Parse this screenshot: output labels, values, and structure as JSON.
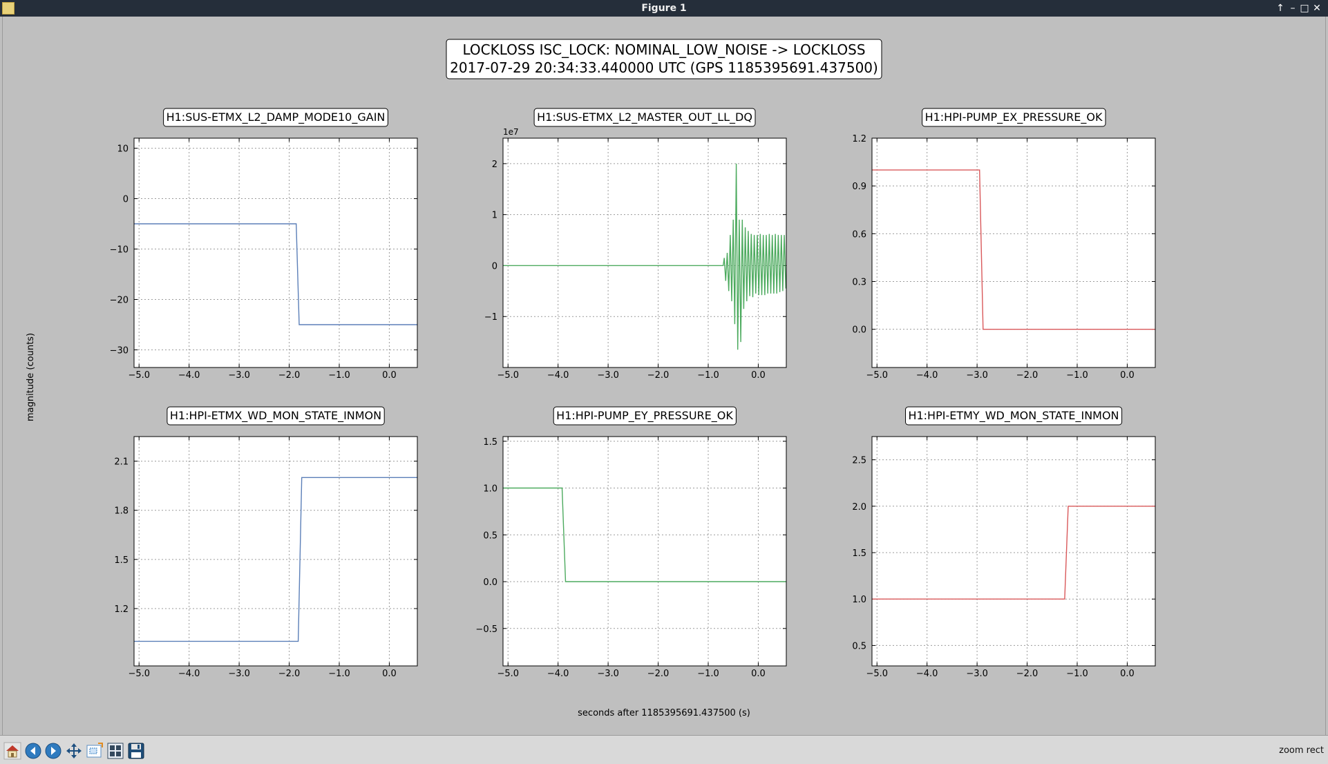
{
  "window": {
    "title": "Figure 1",
    "buttons": {
      "up": "↑",
      "minimize": "–",
      "maximize": "□",
      "close": "✕"
    }
  },
  "figure": {
    "suptitle_line1": "LOCKLOSS ISC_LOCK: NOMINAL_LOW_NOISE -> LOCKLOSS",
    "suptitle_line2": "2017-07-29 20:34:33.440000 UTC (GPS 1185395691.437500)",
    "ylabel": "magnitude (counts)",
    "xlabel": "seconds after 1185395691.437500 (s)"
  },
  "toolbar": {
    "icons": [
      "home-icon",
      "back-arrow-icon",
      "forward-arrow-icon",
      "pan-move-icon",
      "zoom-rect-icon",
      "configure-subplots-icon",
      "save-figure-icon"
    ],
    "status": "zoom rect"
  },
  "chart_data": [
    {
      "type": "line",
      "title": "H1:SUS-ETMX_L2_DAMP_MODE10_GAIN",
      "color": "#5b7fb8",
      "xlim": [
        -5.1,
        0.56
      ],
      "ylim": [
        -33.5,
        12.0
      ],
      "xticks": [
        -5.0,
        -4.0,
        -3.0,
        -2.0,
        -1.0,
        0.0
      ],
      "xtick_labels": [
        "−5.0",
        "−4.0",
        "−3.0",
        "−2.0",
        "−1.0",
        "0.0"
      ],
      "yticks": [
        10,
        0,
        -10,
        -20,
        -30
      ],
      "ytick_labels": [
        "10",
        "0",
        "−10",
        "−20",
        "−30"
      ],
      "grid": true,
      "x": [
        -5.1,
        -1.86,
        -1.8,
        0.56
      ],
      "y": [
        -5,
        -5,
        -25,
        -25
      ]
    },
    {
      "type": "line",
      "title": "H1:SUS-ETMX_L2_MASTER_OUT_LL_DQ",
      "color": "#4caa5e",
      "xlim": [
        -5.1,
        0.56
      ],
      "ylim": [
        -2.0,
        2.5
      ],
      "offset_text": "1e7",
      "xticks": [
        -5.0,
        -4.0,
        -3.0,
        -2.0,
        -1.0,
        0.0
      ],
      "xtick_labels": [
        "−5.0",
        "−4.0",
        "−3.0",
        "−2.0",
        "−1.0",
        "0.0"
      ],
      "yticks": [
        2,
        1,
        0,
        -1
      ],
      "ytick_labels": [
        "2",
        "1",
        "0",
        "−1"
      ],
      "grid": true,
      "x": [
        -5.1,
        -0.7,
        -0.68,
        -0.65,
        -0.62,
        -0.59,
        -0.56,
        -0.53,
        -0.5,
        -0.47,
        -0.44,
        -0.41,
        -0.38,
        -0.35,
        -0.32,
        -0.29,
        -0.26,
        -0.23,
        -0.2,
        -0.17,
        -0.14,
        -0.11,
        -0.08,
        -0.05,
        -0.02,
        0.01,
        0.04,
        0.07,
        0.1,
        0.13,
        0.16,
        0.19,
        0.22,
        0.25,
        0.28,
        0.31,
        0.34,
        0.37,
        0.4,
        0.43,
        0.46,
        0.49,
        0.52,
        0.55
      ],
      "y": [
        0,
        0,
        0.15,
        -0.3,
        0.25,
        -0.5,
        0.6,
        -0.7,
        0.9,
        -1.15,
        2.0,
        -1.65,
        0.9,
        -1.5,
        0.9,
        -0.85,
        0.75,
        -0.7,
        0.68,
        -0.6,
        0.62,
        -0.62,
        0.6,
        -0.55,
        0.6,
        -0.58,
        0.62,
        -0.58,
        0.6,
        -0.58,
        0.6,
        -0.55,
        0.62,
        -0.55,
        0.6,
        -0.55,
        0.62,
        -0.55,
        0.6,
        -0.52,
        0.6,
        -0.5,
        0.6,
        -0.45
      ]
    },
    {
      "type": "line",
      "title": "H1:HPI-PUMP_EX_PRESSURE_OK",
      "color": "#d9585a",
      "xlim": [
        -5.1,
        0.56
      ],
      "ylim": [
        -0.24,
        1.2
      ],
      "xticks": [
        -5.0,
        -4.0,
        -3.0,
        -2.0,
        -1.0,
        0.0
      ],
      "xtick_labels": [
        "−5.0",
        "−4.0",
        "−3.0",
        "−2.0",
        "−1.0",
        "0.0"
      ],
      "yticks": [
        1.2,
        0.9,
        0.6,
        0.3,
        0.0
      ],
      "ytick_labels": [
        "1.2",
        "0.9",
        "0.6",
        "0.3",
        "0.0"
      ],
      "grid": true,
      "x": [
        -5.1,
        -2.95,
        -2.88,
        0.56
      ],
      "y": [
        1,
        1,
        0,
        0
      ]
    },
    {
      "type": "line",
      "title": "H1:HPI-ETMX_WD_MON_STATE_INMON",
      "color": "#5b7fb8",
      "xlim": [
        -5.1,
        0.56
      ],
      "ylim": [
        0.85,
        2.25
      ],
      "xticks": [
        -5.0,
        -4.0,
        -3.0,
        -2.0,
        -1.0,
        0.0
      ],
      "xtick_labels": [
        "−5.0",
        "−4.0",
        "−3.0",
        "−2.0",
        "−1.0",
        "0.0"
      ],
      "yticks": [
        2.1,
        1.8,
        1.5,
        1.2
      ],
      "ytick_labels": [
        "2.1",
        "1.8",
        "1.5",
        "1.2"
      ],
      "grid": true,
      "x": [
        -5.1,
        -1.82,
        -1.75,
        0.56
      ],
      "y": [
        1,
        1,
        2,
        2
      ]
    },
    {
      "type": "line",
      "title": "H1:HPI-PUMP_EY_PRESSURE_OK",
      "color": "#4caa5e",
      "xlim": [
        -5.1,
        0.56
      ],
      "ylim": [
        -0.9,
        1.55
      ],
      "xticks": [
        -5.0,
        -4.0,
        -3.0,
        -2.0,
        -1.0,
        0.0
      ],
      "xtick_labels": [
        "−5.0",
        "−4.0",
        "−3.0",
        "−2.0",
        "−1.0",
        "0.0"
      ],
      "yticks": [
        1.5,
        1.0,
        0.5,
        0.0,
        -0.5
      ],
      "ytick_labels": [
        "1.5",
        "1.0",
        "0.5",
        "0.0",
        "−0.5"
      ],
      "grid": true,
      "x": [
        -5.1,
        -3.92,
        -3.85,
        0.56
      ],
      "y": [
        1,
        1,
        0,
        0
      ]
    },
    {
      "type": "line",
      "title": "H1:HPI-ETMY_WD_MON_STATE_INMON",
      "color": "#d9585a",
      "xlim": [
        -5.1,
        0.56
      ],
      "ylim": [
        0.28,
        2.75
      ],
      "xticks": [
        -5.0,
        -4.0,
        -3.0,
        -2.0,
        -1.0,
        0.0
      ],
      "xtick_labels": [
        "−5.0",
        "−4.0",
        "−3.0",
        "−2.0",
        "−1.0",
        "0.0"
      ],
      "yticks": [
        2.5,
        2.0,
        1.5,
        1.0,
        0.5
      ],
      "ytick_labels": [
        "2.5",
        "2.0",
        "1.5",
        "1.0",
        "0.5"
      ],
      "grid": true,
      "x": [
        -5.1,
        -1.25,
        -1.18,
        0.56
      ],
      "y": [
        1,
        1,
        2,
        2
      ]
    }
  ]
}
